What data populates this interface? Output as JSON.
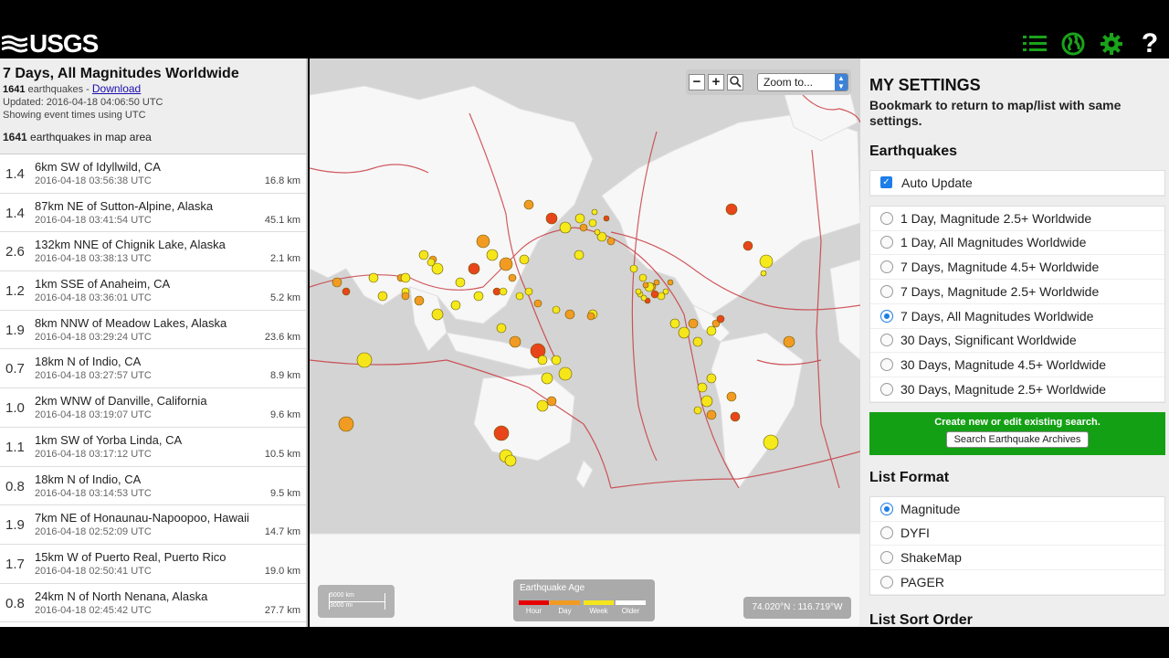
{
  "header": {
    "logo_text": "USGS",
    "icons": [
      "list-icon",
      "globe-icon",
      "gear-icon",
      "help-icon"
    ],
    "help_glyph": "?"
  },
  "list": {
    "title": "7 Days, All Magnitudes Worldwide",
    "count": "1641",
    "count_suffix": " earthquakes - ",
    "download_label": "Download",
    "updated": "Updated: 2016-04-18 04:06:50 UTC",
    "time_note": "Showing event times using UTC",
    "map_count": "1641",
    "map_count_suffix": " earthquakes in map area",
    "items": [
      {
        "mag": "1.4",
        "place": "6km SW of Idyllwild, CA",
        "time": "2016-04-18 03:56:38 UTC",
        "depth": "16.8 km"
      },
      {
        "mag": "1.4",
        "place": "87km NE of Sutton-Alpine, Alaska",
        "time": "2016-04-18 03:41:54 UTC",
        "depth": "45.1 km"
      },
      {
        "mag": "2.6",
        "place": "132km NNE of Chignik Lake, Alaska",
        "time": "2016-04-18 03:38:13 UTC",
        "depth": "2.1 km"
      },
      {
        "mag": "1.2",
        "place": "1km SSE of Anaheim, CA",
        "time": "2016-04-18 03:36:01 UTC",
        "depth": "5.2 km"
      },
      {
        "mag": "1.9",
        "place": "8km NNW of Meadow Lakes, Alaska",
        "time": "2016-04-18 03:29:24 UTC",
        "depth": "23.6 km"
      },
      {
        "mag": "0.7",
        "place": "18km N of Indio, CA",
        "time": "2016-04-18 03:27:57 UTC",
        "depth": "8.9 km"
      },
      {
        "mag": "1.0",
        "place": "2km WNW of Danville, California",
        "time": "2016-04-18 03:19:07 UTC",
        "depth": "9.6 km"
      },
      {
        "mag": "1.1",
        "place": "1km SW of Yorba Linda, CA",
        "time": "2016-04-18 03:17:12 UTC",
        "depth": "10.5 km"
      },
      {
        "mag": "0.8",
        "place": "18km N of Indio, CA",
        "time": "2016-04-18 03:14:53 UTC",
        "depth": "9.5 km"
      },
      {
        "mag": "1.9",
        "place": "7km NE of Honaunau-Napoopoo, Hawaii",
        "time": "2016-04-18 02:52:09 UTC",
        "depth": "14.7 km"
      },
      {
        "mag": "1.7",
        "place": "15km W of Puerto Real, Puerto Rico",
        "time": "2016-04-18 02:50:41 UTC",
        "depth": "19.0 km"
      },
      {
        "mag": "0.8",
        "place": "24km N of North Nenana, Alaska",
        "time": "2016-04-18 02:45:42 UTC",
        "depth": "27.7 km"
      }
    ]
  },
  "map": {
    "zoom_minus": "−",
    "zoom_plus": "+",
    "zoom_to": "Zoom to...",
    "scale_km": "5000 km",
    "scale_mi": "3000 mi",
    "age_title": "Earthquake Age",
    "age_labels": [
      "Hour",
      "Day",
      "Week",
      "Older"
    ],
    "age_colors": [
      "#e60000",
      "#f29b22",
      "#f5e51b",
      "#ffffff"
    ],
    "coords": "74.020°N : 116.719°W"
  },
  "settings": {
    "title": "MY SETTINGS",
    "subtitle": "Bookmark to return to map/list with same settings.",
    "earthquakes_heading": "Earthquakes",
    "auto_update": "Auto Update",
    "feeds": [
      {
        "label": "1 Day, Magnitude 2.5+ Worldwide",
        "selected": false
      },
      {
        "label": "1 Day, All Magnitudes Worldwide",
        "selected": false
      },
      {
        "label": "7 Days, Magnitude 4.5+ Worldwide",
        "selected": false
      },
      {
        "label": "7 Days, Magnitude 2.5+ Worldwide",
        "selected": false
      },
      {
        "label": "7 Days, All Magnitudes Worldwide",
        "selected": true
      },
      {
        "label": "30 Days, Significant Worldwide",
        "selected": false
      },
      {
        "label": "30 Days, Magnitude 4.5+ Worldwide",
        "selected": false
      },
      {
        "label": "30 Days, Magnitude 2.5+ Worldwide",
        "selected": false
      }
    ],
    "create_search": "Create new or edit existing search.",
    "search_archives": "Search Earthquake Archives",
    "list_format_heading": "List Format",
    "formats": [
      {
        "label": "Magnitude",
        "selected": true
      },
      {
        "label": "DYFI",
        "selected": false
      },
      {
        "label": "ShakeMap",
        "selected": false
      },
      {
        "label": "PAGER",
        "selected": false
      }
    ],
    "sort_heading": "List Sort Order"
  }
}
